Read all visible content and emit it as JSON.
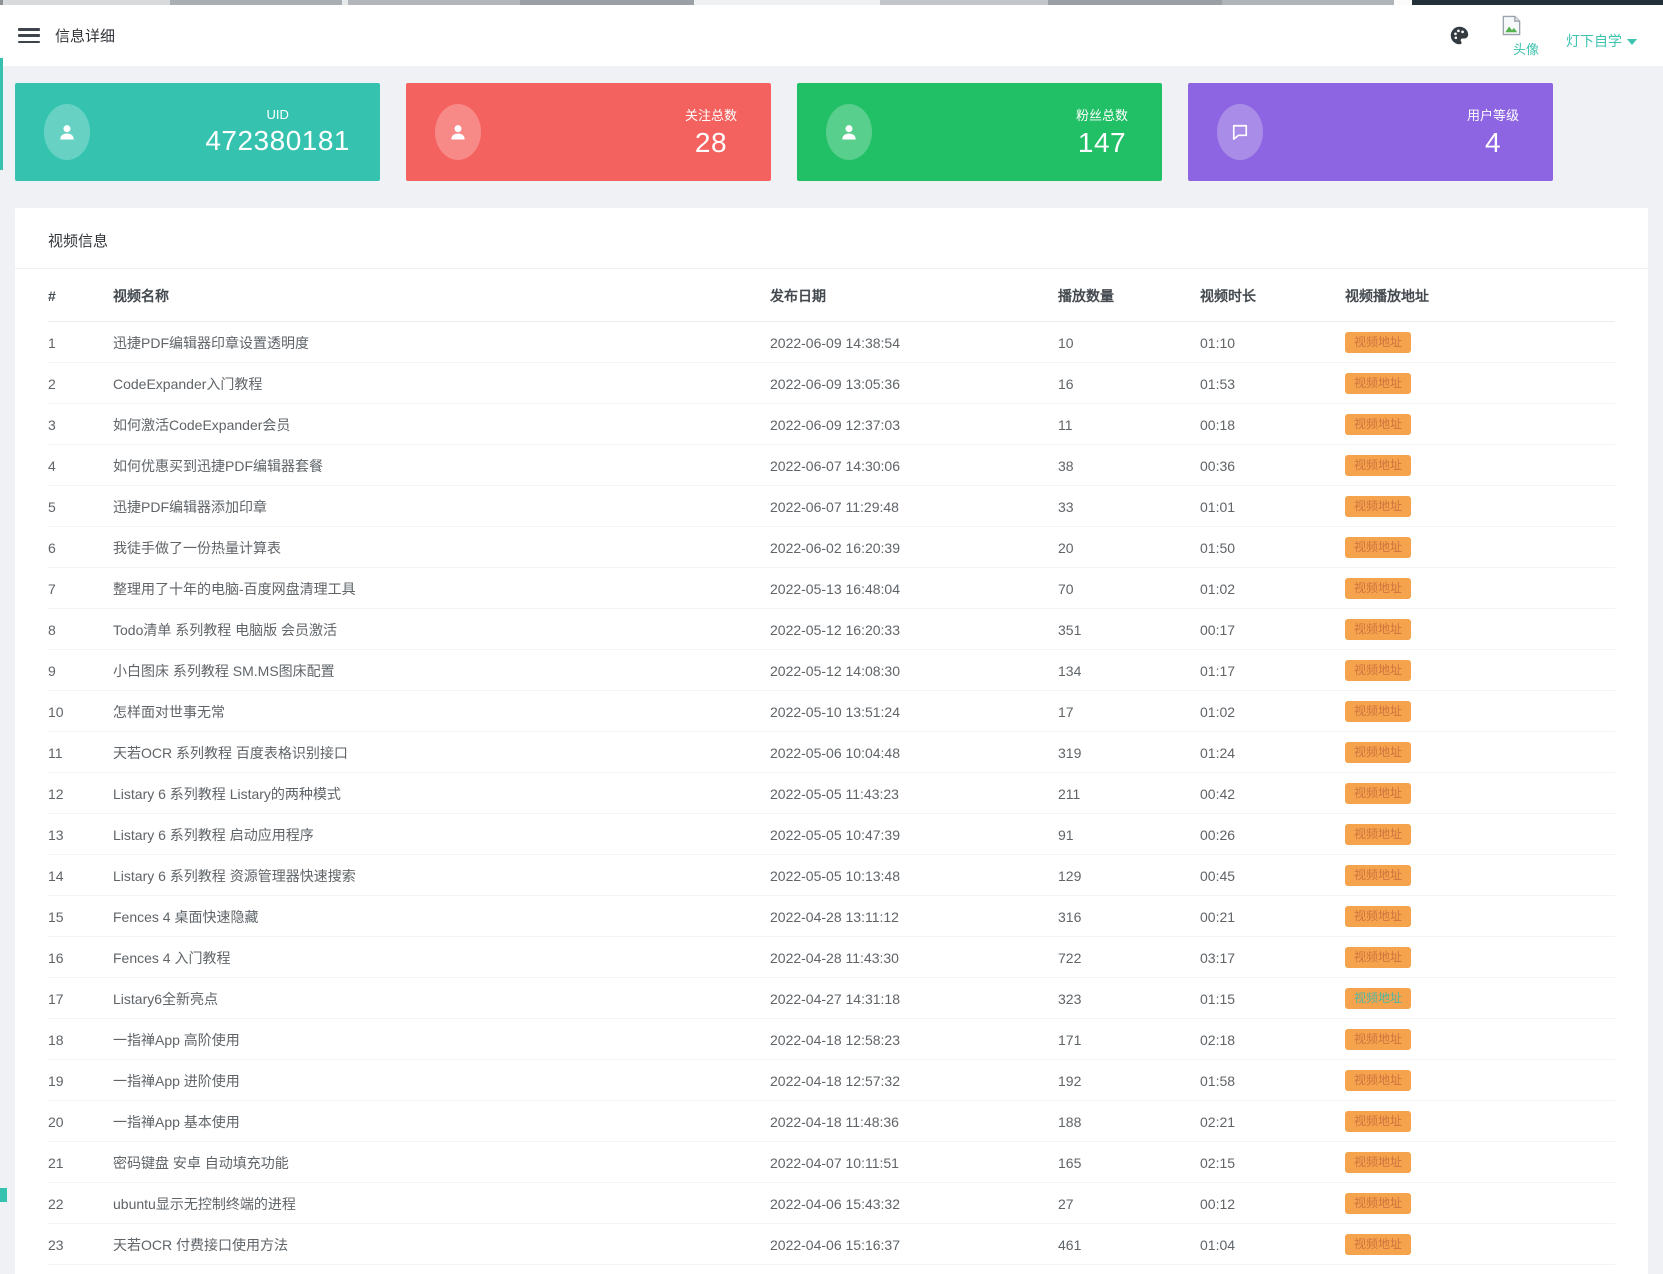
{
  "header": {
    "title": "信息详细",
    "avatar_alt": "头像",
    "username": "灯下自学",
    "accent_color": "#3ec3ae"
  },
  "icons": {
    "menu": "hamburger-icon",
    "theme": "palette-icon",
    "avatar": "broken-image-icon",
    "dropdown": "caret-down-icon",
    "stat_user": "person-icon",
    "stat_level": "chat-bubble-icon"
  },
  "cards": [
    {
      "key": "uid",
      "label": "UID",
      "value": "472380181",
      "color": "#35c3b0",
      "icon": "person"
    },
    {
      "key": "following",
      "label": "关注总数",
      "value": "28",
      "color": "#f4625f",
      "icon": "person"
    },
    {
      "key": "fans",
      "label": "粉丝总数",
      "value": "147",
      "color": "#21bf66",
      "icon": "person"
    },
    {
      "key": "level",
      "label": "用户等级",
      "value": "4",
      "color": "#8d64e1",
      "icon": "chat"
    }
  ],
  "panel": {
    "title": "视频信息"
  },
  "table": {
    "columns": [
      "#",
      "视频名称",
      "发布日期",
      "播放数量",
      "视频时长",
      "视频播放地址"
    ],
    "button_label": "视频地址",
    "button_color": "#f5a34c",
    "rows": [
      {
        "index": "1",
        "name": "迅捷PDF编辑器印章设置透明度",
        "date": "2022-06-09 14:38:54",
        "plays": "10",
        "duration": "01:10",
        "visited": false
      },
      {
        "index": "2",
        "name": "CodeExpander入门教程",
        "date": "2022-06-09 13:05:36",
        "plays": "16",
        "duration": "01:53",
        "visited": false
      },
      {
        "index": "3",
        "name": "如何激活CodeExpander会员",
        "date": "2022-06-09 12:37:03",
        "plays": "11",
        "duration": "00:18",
        "visited": false
      },
      {
        "index": "4",
        "name": "如何优惠买到迅捷PDF编辑器套餐",
        "date": "2022-06-07 14:30:06",
        "plays": "38",
        "duration": "00:36",
        "visited": false
      },
      {
        "index": "5",
        "name": "迅捷PDF编辑器添加印章",
        "date": "2022-06-07 11:29:48",
        "plays": "33",
        "duration": "01:01",
        "visited": false
      },
      {
        "index": "6",
        "name": "我徒手做了一份热量计算表",
        "date": "2022-06-02 16:20:39",
        "plays": "20",
        "duration": "01:50",
        "visited": false
      },
      {
        "index": "7",
        "name": "整理用了十年的电脑-百度网盘清理工具",
        "date": "2022-05-13 16:48:04",
        "plays": "70",
        "duration": "01:02",
        "visited": false
      },
      {
        "index": "8",
        "name": "Todo清单 系列教程 电脑版 会员激活",
        "date": "2022-05-12 16:20:33",
        "plays": "351",
        "duration": "00:17",
        "visited": false
      },
      {
        "index": "9",
        "name": "小白图床 系列教程 SM.MS图床配置",
        "date": "2022-05-12 14:08:30",
        "plays": "134",
        "duration": "01:17",
        "visited": false
      },
      {
        "index": "10",
        "name": "怎样面对世事无常",
        "date": "2022-05-10 13:51:24",
        "plays": "17",
        "duration": "01:02",
        "visited": false
      },
      {
        "index": "11",
        "name": "天若OCR 系列教程 百度表格识别接口",
        "date": "2022-05-06 10:04:48",
        "plays": "319",
        "duration": "01:24",
        "visited": false
      },
      {
        "index": "12",
        "name": "Listary 6 系列教程 Listary的两种模式",
        "date": "2022-05-05 11:43:23",
        "plays": "211",
        "duration": "00:42",
        "visited": false
      },
      {
        "index": "13",
        "name": "Listary 6 系列教程 启动应用程序",
        "date": "2022-05-05 10:47:39",
        "plays": "91",
        "duration": "00:26",
        "visited": false
      },
      {
        "index": "14",
        "name": "Listary 6 系列教程 资源管理器快速搜索",
        "date": "2022-05-05 10:13:48",
        "plays": "129",
        "duration": "00:45",
        "visited": false
      },
      {
        "index": "15",
        "name": "Fences 4 桌面快速隐藏",
        "date": "2022-04-28 13:11:12",
        "plays": "316",
        "duration": "00:21",
        "visited": false
      },
      {
        "index": "16",
        "name": "Fences 4 入门教程",
        "date": "2022-04-28 11:43:30",
        "plays": "722",
        "duration": "03:17",
        "visited": false
      },
      {
        "index": "17",
        "name": "Listary6全新亮点",
        "date": "2022-04-27 14:31:18",
        "plays": "323",
        "duration": "01:15",
        "visited": true
      },
      {
        "index": "18",
        "name": "一指禅App 高阶使用",
        "date": "2022-04-18 12:58:23",
        "plays": "171",
        "duration": "02:18",
        "visited": false
      },
      {
        "index": "19",
        "name": "一指禅App 进阶使用",
        "date": "2022-04-18 12:57:32",
        "plays": "192",
        "duration": "01:58",
        "visited": false
      },
      {
        "index": "20",
        "name": "一指禅App 基本使用",
        "date": "2022-04-18 11:48:36",
        "plays": "188",
        "duration": "02:21",
        "visited": false
      },
      {
        "index": "21",
        "name": "密码键盘 安卓 自动填充功能",
        "date": "2022-04-07 10:11:51",
        "plays": "165",
        "duration": "02:15",
        "visited": false
      },
      {
        "index": "22",
        "name": "ubuntu显示无控制终端的进程",
        "date": "2022-04-06 15:43:32",
        "plays": "27",
        "duration": "00:12",
        "visited": false
      },
      {
        "index": "23",
        "name": "天若OCR 付费接口使用方法",
        "date": "2022-04-06 15:16:37",
        "plays": "461",
        "duration": "01:04",
        "visited": false
      }
    ]
  }
}
